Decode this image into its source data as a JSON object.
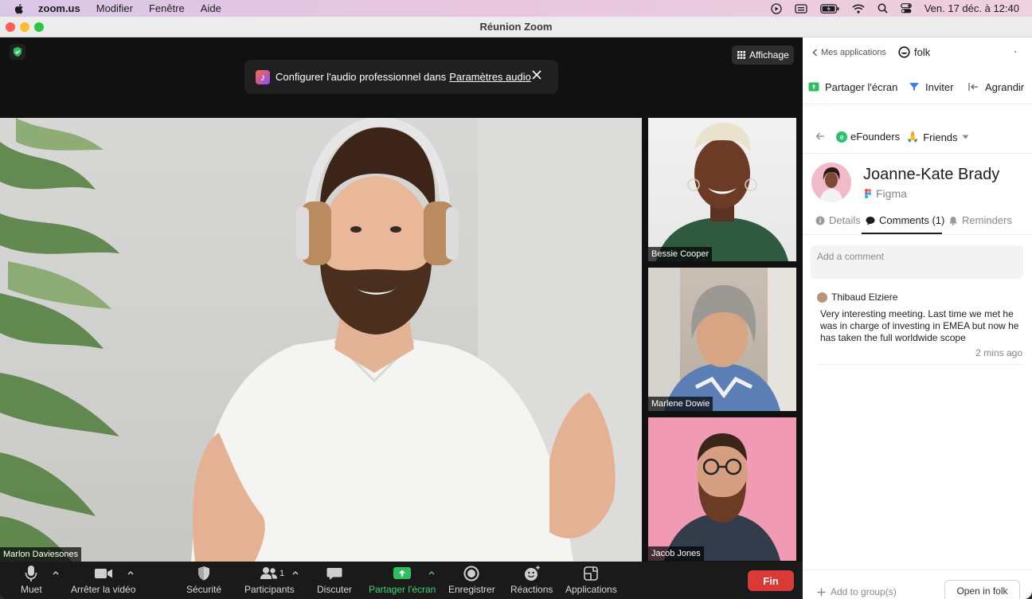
{
  "menubar": {
    "app": "zoom.us",
    "items": [
      "Modifier",
      "Fenêtre",
      "Aide"
    ],
    "clock": "Ven. 17 déc. à  12:40"
  },
  "window": {
    "title": "Réunion Zoom"
  },
  "zoom": {
    "view_button": "Affichage",
    "banner": {
      "text": "Configurer l'audio professionnel dans",
      "link": "Paramètres audio"
    },
    "participants": {
      "main": "Marlon Daviesones",
      "thumbs": [
        "Bessie Cooper",
        "Marlene Dowie",
        "Jacob Jones"
      ]
    },
    "toolbar": {
      "mute": "Muet",
      "video": "Arrêter la vidéo",
      "security": "Sécurité",
      "participants": "Participants",
      "participants_count": "1",
      "chat": "Discuter",
      "share": "Partager l'écran",
      "record": "Enregistrer",
      "reactions": "Réactions",
      "apps": "Applications",
      "end": "Fin"
    }
  },
  "folk": {
    "back": "Mes applications",
    "app_name": "folk",
    "actions": {
      "share": "Partager l'écran",
      "invite": "Inviter",
      "expand": "Agrandir"
    },
    "crumbs": {
      "group": "eFounders",
      "list": "Friends",
      "list_emoji": "🙏"
    },
    "contact": {
      "name": "Joanne-Kate Brady",
      "company": "Figma"
    },
    "tabs": {
      "details": "Details",
      "comments": "Comments (1)",
      "reminders": "Reminders"
    },
    "comment_placeholder": "Add a comment",
    "comment": {
      "author": "Thibaud Elziere",
      "text": "Very interesting meeting. Last time we met he was in charge of investing in EMEA but now he has taken the full worldwide scope",
      "time": "2 mins ago"
    },
    "footer": {
      "add_group": "Add to group(s)",
      "open": "Open in folk"
    }
  },
  "colors": {
    "end_red": "#d93a38",
    "zoom_green": "#3dd46e",
    "folk_green": "#2bc26b"
  }
}
